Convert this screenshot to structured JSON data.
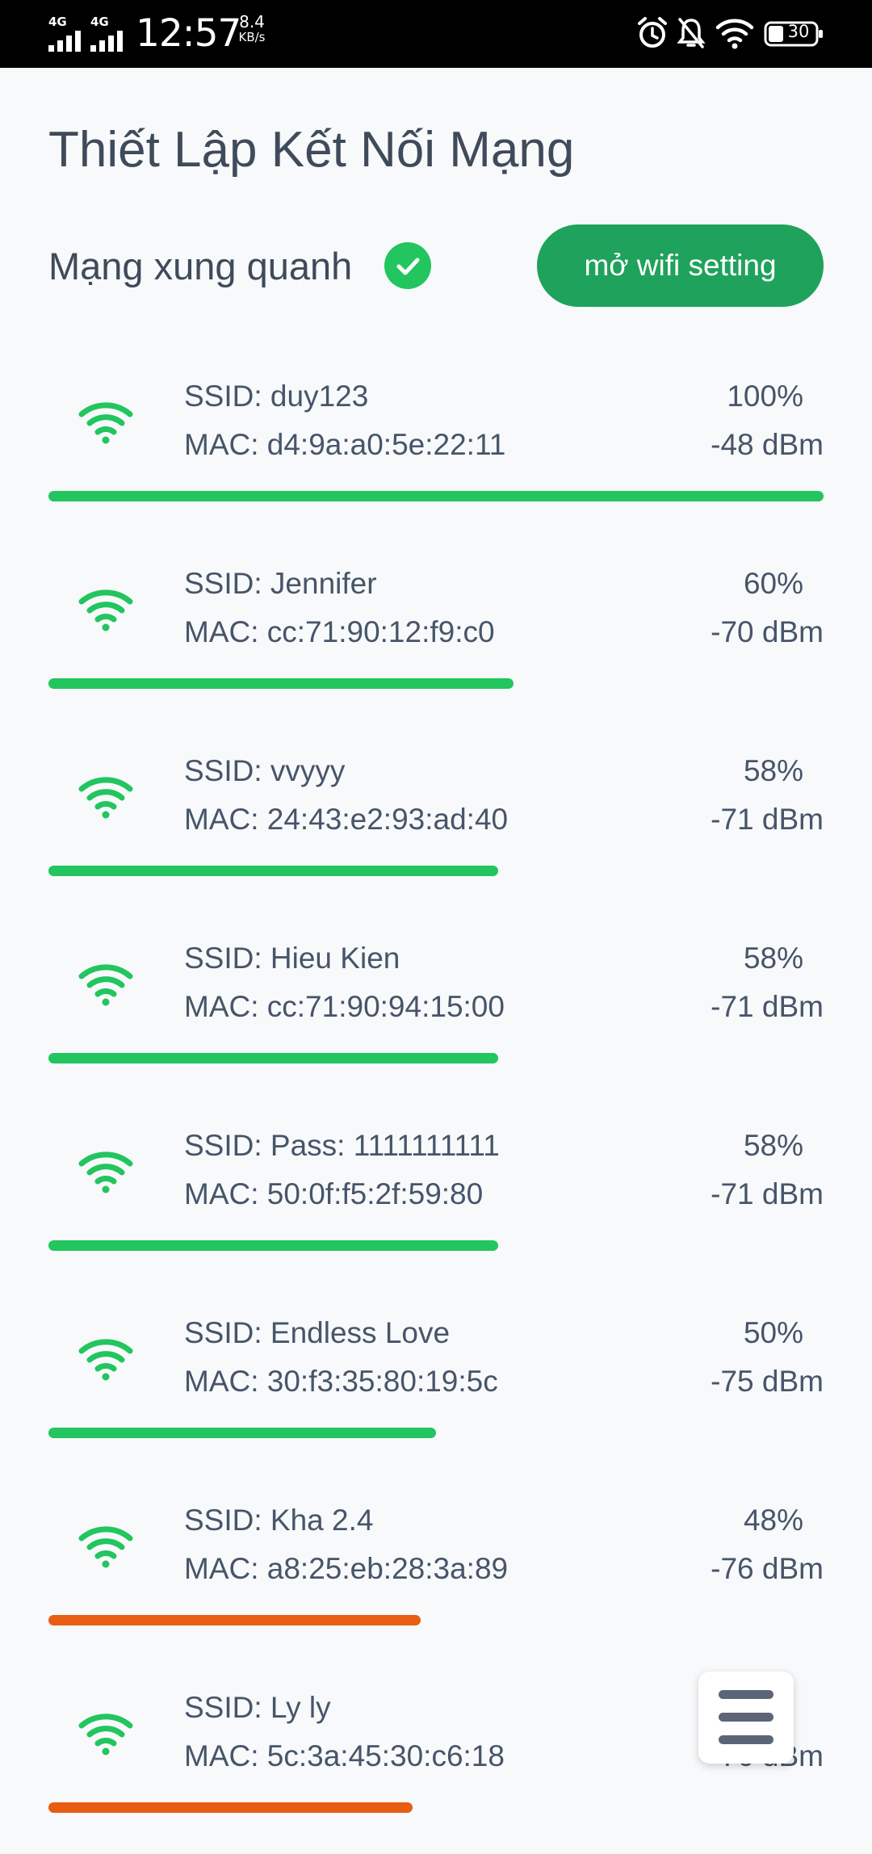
{
  "status_bar": {
    "sim1": "4G",
    "sim2": "4G",
    "time": "12:57",
    "speed_value": "8.4",
    "speed_unit": "KB/s",
    "battery": "30"
  },
  "header": {
    "title": "Thiết Lập Kết Nối Mạng",
    "section_title": "Mạng xung quanh",
    "wifi_settings_button": "mở wifi setting"
  },
  "colors": {
    "strong": "#22c55e",
    "weak": "#e85d12",
    "button": "#1fa25b"
  },
  "networks": [
    {
      "ssid": "SSID: duy123",
      "mac": "MAC: d4:9a:a0:5e:22:11",
      "percent_label": "100%",
      "dbm": "-48 dBm",
      "level": 1.0,
      "status": "strong"
    },
    {
      "ssid": "SSID: Jennifer",
      "mac": "MAC: cc:71:90:12:f9:c0",
      "percent_label": "60%",
      "dbm": "-70 dBm",
      "level": 0.6,
      "status": "strong"
    },
    {
      "ssid": "SSID: vvyyy",
      "mac": "MAC: 24:43:e2:93:ad:40",
      "percent_label": "58%",
      "dbm": "-71 dBm",
      "level": 0.58,
      "status": "strong"
    },
    {
      "ssid": "SSID: Hieu Kien",
      "mac": "MAC: cc:71:90:94:15:00",
      "percent_label": "58%",
      "dbm": "-71 dBm",
      "level": 0.58,
      "status": "strong"
    },
    {
      "ssid": "SSID: Pass: 1111111111",
      "mac": "MAC: 50:0f:f5:2f:59:80",
      "percent_label": "58%",
      "dbm": "-71 dBm",
      "level": 0.58,
      "status": "strong"
    },
    {
      "ssid": "SSID: Endless Love",
      "mac": "MAC: 30:f3:35:80:19:5c",
      "percent_label": "50%",
      "dbm": "-75 dBm",
      "level": 0.5,
      "status": "strong"
    },
    {
      "ssid": "SSID: Kha 2.4",
      "mac": "MAC: a8:25:eb:28:3a:89",
      "percent_label": "48%",
      "dbm": "-76 dBm",
      "level": 0.48,
      "status": "weak"
    },
    {
      "ssid": "SSID: Ly ly",
      "mac": "MAC: 5c:3a:45:30:c6:18",
      "percent_label": "",
      "dbm": "-76 dBm",
      "level": 0.47,
      "status": "weak"
    }
  ]
}
